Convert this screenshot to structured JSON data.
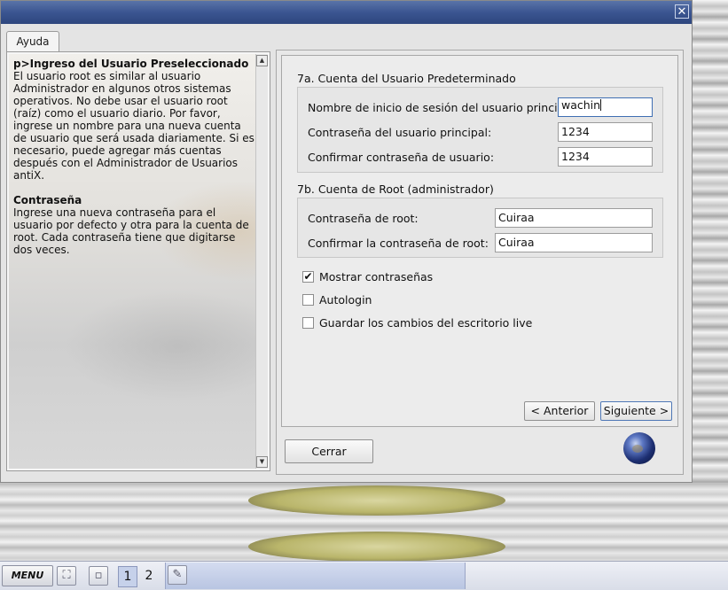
{
  "window": {
    "close_symbol": "✕"
  },
  "help": {
    "tab_label": "Ayuda",
    "heading1": "p>Ingreso del Usuario Preseleccionado",
    "paragraph1": "El usuario root es similar al usuario Administrador en algunos otros sistemas operativos. No debe usar el usuario root (raíz) como el usuario diario. Por favor, ingrese un nombre para una nueva cuenta de usuario que será usada diariamente. Si es necesario, puede agregar más cuentas después con el Administrador de Usuarios antiX.",
    "heading2": "Contraseña",
    "paragraph2": "Ingrese una nueva contraseña para el usuario por defecto y otra para la cuenta de root. Cada contraseña tiene que digitarse dos veces."
  },
  "user_section": {
    "title": "7a. Cuenta del Usuario Predeterminado",
    "login_label": "Nombre de inicio de sesión del usuario principal:",
    "login_value": "wachin",
    "password_label": "Contraseña del usuario principal:",
    "password_value": "1234",
    "confirm_label": "Confirmar contraseña de usuario:",
    "confirm_value": "1234"
  },
  "root_section": {
    "title": "7b. Cuenta de Root (administrador)",
    "password_label": "Contraseña de root:",
    "password_value": "Cuiraa",
    "confirm_label": "Confirmar la contraseña de root:",
    "confirm_value": "Cuiraa"
  },
  "options": {
    "show_passwords": {
      "label": "Mostrar contraseñas",
      "checked": true,
      "mark": "✔"
    },
    "autologin": {
      "label": "Autologin",
      "checked": false
    },
    "save_live": {
      "label": "Guardar los cambios del escritorio live",
      "checked": false
    }
  },
  "buttons": {
    "back": "< Anterior",
    "next": "Siguiente >",
    "close": "Cerrar"
  },
  "taskbar": {
    "menu_label": "MENU",
    "workspace_1": "1",
    "workspace_2": "2"
  }
}
